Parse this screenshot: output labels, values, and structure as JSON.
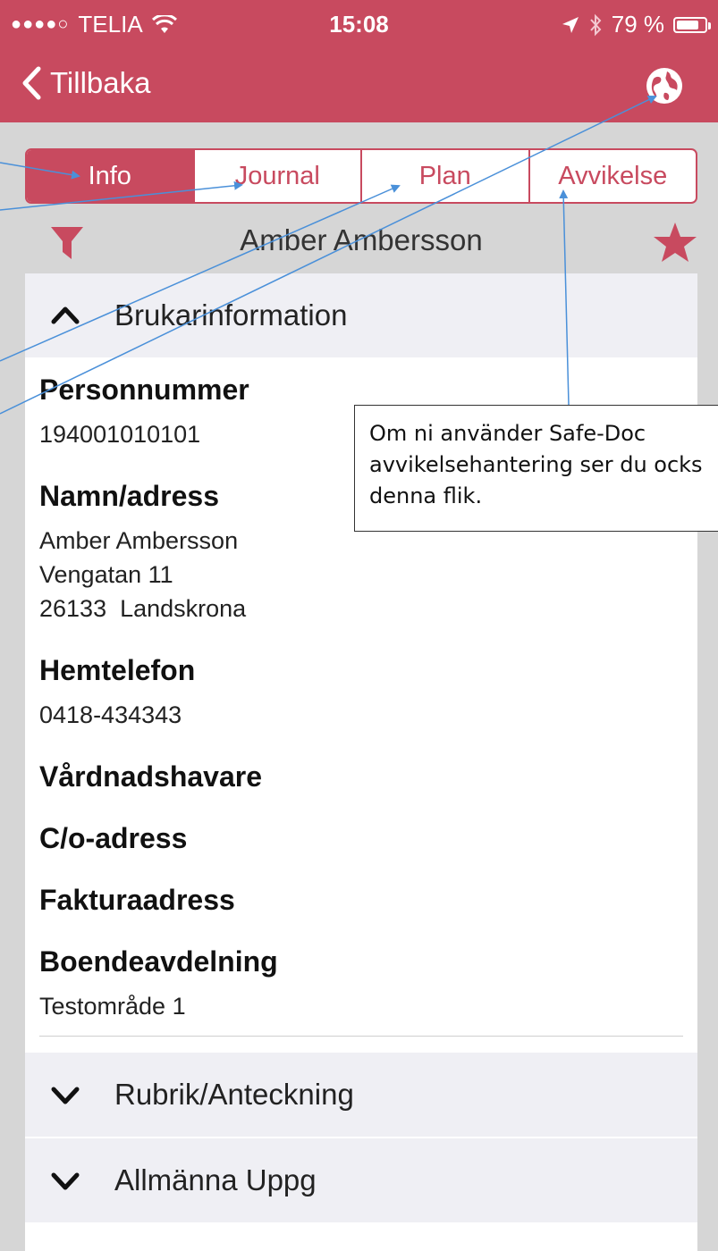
{
  "statusbar": {
    "signal_dots": "●●●●○",
    "carrier": "TELIA",
    "time": "15:08",
    "battery_text": "79 %",
    "battery_level": 0.79
  },
  "nav": {
    "back_label": "Tillbaka"
  },
  "tabs": [
    {
      "label": "Info",
      "active": true
    },
    {
      "label": "Journal",
      "active": false
    },
    {
      "label": "Plan",
      "active": false
    },
    {
      "label": "Avvikelse",
      "active": false
    }
  ],
  "person": {
    "name": "Amber Ambersson"
  },
  "sections": {
    "brukar": {
      "label": "Brukarinformation",
      "expanded": true
    },
    "rubrik": {
      "label": "Rubrik/Anteckning",
      "expanded": false
    },
    "allmanna": {
      "label": "Allmänna Uppg",
      "expanded": false
    }
  },
  "fields": {
    "personnummer": {
      "label": "Personnummer",
      "value": "194001010101"
    },
    "namn_adress": {
      "label": "Namn/adress",
      "lines": [
        "Amber Ambersson",
        "Vengatan 11",
        "26133  Landskrona"
      ]
    },
    "hemtelefon": {
      "label": "Hemtelefon",
      "value": "0418-434343"
    },
    "vardnadshavare": {
      "label": "Vårdnadshavare"
    },
    "co_adress": {
      "label": "C/o-adress"
    },
    "fakturaadress": {
      "label": "Fakturaadress"
    },
    "boendeavdelning": {
      "label": "Boendeavdelning",
      "value": "Testområde 1"
    }
  },
  "callout": {
    "line1": "Om ni använder Safe-Doc",
    "line2": "avvikelsehantering ser du ocks",
    "line3": "denna flik."
  },
  "colors": {
    "accent": "#c84a5f",
    "annotation_line": "#4a90d9",
    "background": "#d6d6d6",
    "section_header": "#efeff4"
  },
  "icons": {
    "back": "chevron-left-icon",
    "globe": "globe-icon",
    "filter": "filter-icon",
    "favorite": "star-icon",
    "expanded": "chevron-up-icon",
    "collapsed": "chevron-down-icon"
  }
}
